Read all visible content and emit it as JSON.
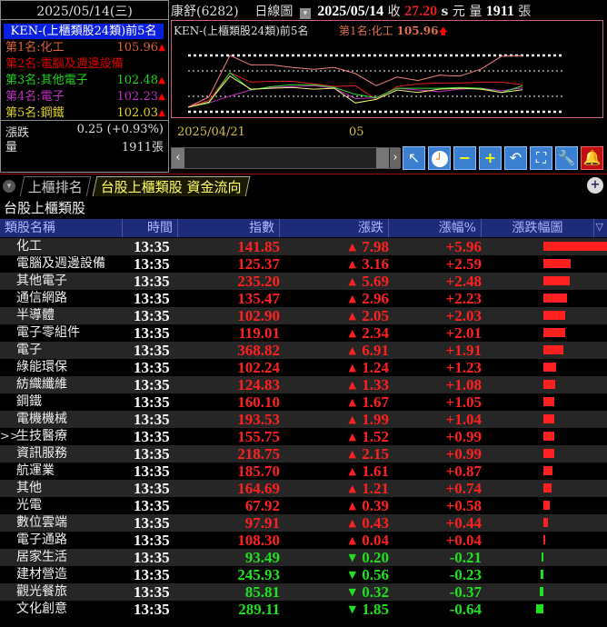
{
  "left_panel": {
    "date": "2025/05/14(三)",
    "rank_title": "KEN-(上櫃類股24類)前5名",
    "ranks": [
      {
        "label": "第1名:化工",
        "value": "105.96",
        "color": "#e06040",
        "up": true
      },
      {
        "label": "第2名:電腦及週邊設備",
        "value": "",
        "color": "#e00000",
        "up": false
      },
      {
        "label": "第3名:其他電子",
        "value": "102.48",
        "color": "#20d020",
        "up": true
      },
      {
        "label": "第4名:電子",
        "value": "102.23",
        "color": "#c030c0",
        "up": true
      },
      {
        "label": "第5名:鋼鐵",
        "value": "102.03",
        "color": "#e0d020",
        "up": true
      }
    ],
    "change_label": "漲跌",
    "change_value": "0.25 (+0.93%)",
    "volume_label": "量",
    "volume_value": "1911張"
  },
  "header": {
    "stock": "康舒(6282)",
    "chart_type": "日線圖",
    "date": "2025/05/14",
    "close_label": "收",
    "close": "27.20",
    "unit_s": "s",
    "unit_yuan": "元",
    "volume_label": "量",
    "volume": "1911",
    "volume_unit": "張"
  },
  "chart": {
    "title": "KEN-(上櫃類股24類)前5名",
    "legend": "第1名:化工",
    "legend_value": "105.96",
    "x_labels": [
      "2025/04/21",
      "05"
    ],
    "series": [
      {
        "color": "#f08080",
        "values": [
          100,
          101.2,
          106,
          104.9,
          104.9,
          104.6,
          104.4,
          104.6,
          103.9,
          102.5,
          103.5,
          103.1,
          103.7,
          103.6,
          104.4,
          105.9,
          105.96
        ]
      },
      {
        "color": "#e02020",
        "values": [
          100,
          100.8,
          104,
          102.9,
          103,
          103,
          102.7,
          102.4,
          102.5,
          100.9,
          102.4,
          102.7,
          102.8,
          102.8,
          102.9,
          102.9,
          102.6
        ]
      },
      {
        "color": "#c030c0",
        "values": [
          100,
          100.5,
          101.3,
          102,
          102.3,
          102.4,
          102.5,
          102.2,
          101,
          101.1,
          102.2,
          102,
          101.8,
          102.1,
          102.2,
          101.9,
          102.23
        ]
      },
      {
        "color": "#30e030",
        "values": [
          100,
          100.5,
          104,
          102,
          102.4,
          102.6,
          102.6,
          102.3,
          101.5,
          101.1,
          102.2,
          102.2,
          102.2,
          102.3,
          102.2,
          101.7,
          102.48
        ]
      },
      {
        "color": "#f0f080",
        "values": [
          100,
          100.6,
          103.6,
          102.1,
          102.2,
          102.3,
          102.1,
          102.2,
          100.5,
          100.9,
          102,
          101.7,
          102.1,
          102.2,
          102.1,
          101.7,
          102.03
        ]
      }
    ]
  },
  "tabs": [
    {
      "label": "上櫃排名"
    },
    {
      "label": "台股上櫃類股 資金流向"
    }
  ],
  "section_title": "台股上櫃類股",
  "columns": [
    "類股名稱",
    "時間",
    "指數",
    "漲跌",
    "漲幅%",
    "漲跌幅圖"
  ],
  "colors": {
    "up": "#ff2020",
    "down": "#20e020"
  },
  "rows": [
    {
      "name": "化工",
      "time": "13:35",
      "index": "141.85",
      "change": "7.98",
      "pct": "+5.96",
      "v": 5.96
    },
    {
      "name": "電腦及週邊設備",
      "time": "13:35",
      "index": "125.37",
      "change": "3.16",
      "pct": "+2.59",
      "v": 2.59
    },
    {
      "name": "其他電子",
      "time": "13:35",
      "index": "235.20",
      "change": "5.69",
      "pct": "+2.48",
      "v": 2.48
    },
    {
      "name": "通信網路",
      "time": "13:35",
      "index": "135.47",
      "change": "2.96",
      "pct": "+2.23",
      "v": 2.23
    },
    {
      "name": "半導體",
      "time": "13:35",
      "index": "102.90",
      "change": "2.05",
      "pct": "+2.03",
      "v": 2.03
    },
    {
      "name": "電子零組件",
      "time": "13:35",
      "index": "119.01",
      "change": "2.34",
      "pct": "+2.01",
      "v": 2.01
    },
    {
      "name": "電子",
      "time": "13:35",
      "index": "368.82",
      "change": "6.91",
      "pct": "+1.91",
      "v": 1.91
    },
    {
      "name": "綠能環保",
      "time": "13:35",
      "index": "102.24",
      "change": "1.24",
      "pct": "+1.23",
      "v": 1.23
    },
    {
      "name": "紡織纖維",
      "time": "13:35",
      "index": "124.83",
      "change": "1.33",
      "pct": "+1.08",
      "v": 1.08
    },
    {
      "name": "鋼鐵",
      "time": "13:35",
      "index": "160.10",
      "change": "1.67",
      "pct": "+1.05",
      "v": 1.05
    },
    {
      "name": "電機機械",
      "time": "13:35",
      "index": "193.53",
      "change": "1.99",
      "pct": "+1.04",
      "v": 1.04
    },
    {
      "name": "生技醫療",
      "time": "13:35",
      "index": "155.75",
      "change": "1.52",
      "pct": "+0.99",
      "v": 0.99,
      "marker": ">>"
    },
    {
      "name": "資訊服務",
      "time": "13:35",
      "index": "218.75",
      "change": "2.15",
      "pct": "+0.99",
      "v": 0.99
    },
    {
      "name": "航運業",
      "time": "13:35",
      "index": "185.70",
      "change": "1.61",
      "pct": "+0.87",
      "v": 0.87
    },
    {
      "name": "其他",
      "time": "13:35",
      "index": "164.69",
      "change": "1.21",
      "pct": "+0.74",
      "v": 0.74
    },
    {
      "name": "光電",
      "time": "13:35",
      "index": "67.92",
      "change": "0.39",
      "pct": "+0.58",
      "v": 0.58
    },
    {
      "name": "數位雲端",
      "time": "13:35",
      "index": "97.91",
      "change": "0.43",
      "pct": "+0.44",
      "v": 0.44
    },
    {
      "name": "電子通路",
      "time": "13:35",
      "index": "108.30",
      "change": "0.04",
      "pct": "+0.04",
      "v": 0.04
    },
    {
      "name": "居家生活",
      "time": "13:35",
      "index": "93.49",
      "change": "0.20",
      "pct": "-0.21",
      "v": -0.21
    },
    {
      "name": "建材營造",
      "time": "13:35",
      "index": "245.93",
      "change": "0.56",
      "pct": "-0.23",
      "v": -0.23
    },
    {
      "name": "觀光餐旅",
      "time": "13:35",
      "index": "85.81",
      "change": "0.32",
      "pct": "-0.37",
      "v": -0.37
    },
    {
      "name": "文化創意",
      "time": "13:35",
      "index": "289.11",
      "change": "1.85",
      "pct": "-0.64",
      "v": -0.64
    }
  ]
}
